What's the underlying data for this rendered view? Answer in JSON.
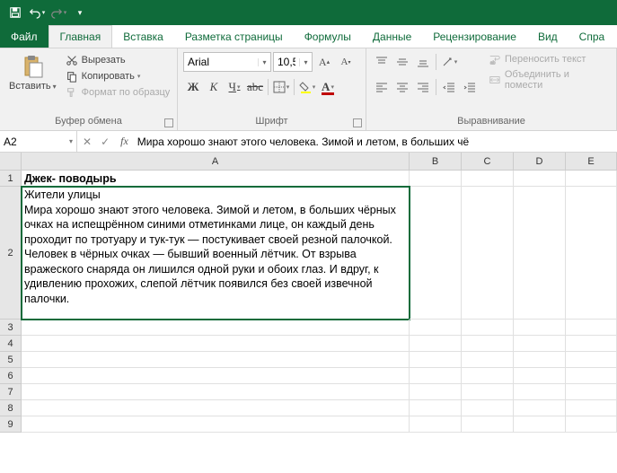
{
  "qat": {
    "save": "save-icon",
    "undo": "undo-icon",
    "redo": "redo-icon"
  },
  "tabs": {
    "file": "Файл",
    "home": "Главная",
    "insert": "Вставка",
    "page_layout": "Разметка страницы",
    "formulas": "Формулы",
    "data": "Данные",
    "review": "Рецензирование",
    "view": "Вид",
    "help": "Спра"
  },
  "ribbon": {
    "clipboard": {
      "label": "Буфер обмена",
      "paste": "Вставить",
      "cut": "Вырезать",
      "copy": "Копировать",
      "format_painter": "Формат по образцу"
    },
    "font": {
      "label": "Шрифт",
      "name": "Arial",
      "size": "10,5"
    },
    "alignment": {
      "label": "Выравнивание",
      "wrap": "Переносить текст",
      "merge": "Объединить и помести"
    }
  },
  "namebox": "A2",
  "formula": "Мира хорошо знают этого человека. Зимой и летом, в больших чё",
  "columns": [
    "A",
    "B",
    "C",
    "D",
    "E"
  ],
  "rows": [
    "1",
    "2",
    "3",
    "4",
    "5",
    "6",
    "7",
    "8",
    "9"
  ],
  "cells": {
    "a1": "Джек- поводырь",
    "a2": "Жители улицы\nМира хорошо знают этого человека. Зимой и летом, в больших чёрных очках на испещрённом синими отметинками лице, он каждый день проходит по тротуару и тук-тук — постукивает своей резной палочкой. Человек в чёрных очках — бывший военный лётчик. От взрыва вражеского снаряда он лишился одной руки и обоих глаз. И вдруг, к удивлению прохожих, слепой лётчик появился без своей извечной палочки."
  },
  "row_heights": {
    "r1": 18,
    "r2": 148,
    "default": 18
  }
}
